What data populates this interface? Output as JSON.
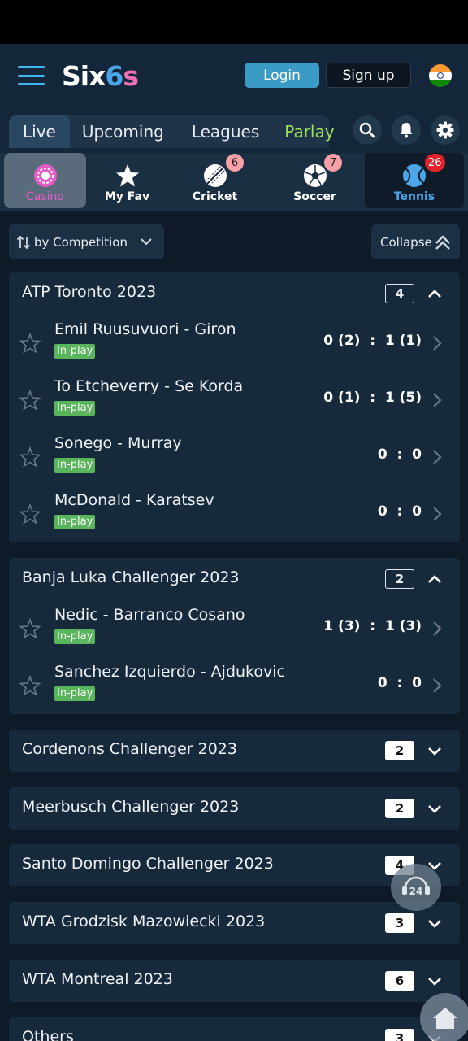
{
  "header": {
    "logo": {
      "part1": "Six",
      "part2": "6",
      "part3": "s"
    },
    "login_label": "Login",
    "signup_label": "Sign up",
    "flag": "india-flag-icon"
  },
  "tabs": [
    {
      "label": "Live",
      "active": true
    },
    {
      "label": "Upcoming"
    },
    {
      "label": "Leagues"
    },
    {
      "label": "Parlay"
    }
  ],
  "sports": [
    {
      "label": "Casino"
    },
    {
      "label": "My Fav"
    },
    {
      "label": "Cricket",
      "badge": "6"
    },
    {
      "label": "Soccer",
      "badge": "7"
    },
    {
      "label": "Tennis",
      "badge": "26",
      "active": true
    }
  ],
  "controls": {
    "sort_label": "by Competition",
    "collapse_label": "Collapse"
  },
  "competitions": [
    {
      "name": "ATP Toronto 2023",
      "count": "4",
      "expanded": true,
      "matches": [
        {
          "name": "Emil Ruusuvuori - Giron",
          "status": "In-play",
          "score": "0 (2)  :  1 (1)"
        },
        {
          "name": "To Etcheverry - Se Korda",
          "status": "In-play",
          "score": "0 (1)  :  1 (5)"
        },
        {
          "name": "Sonego - Murray",
          "status": "In-play",
          "score": "0  :  0"
        },
        {
          "name": "McDonald - Karatsev",
          "status": "In-play",
          "score": "0  :  0"
        }
      ]
    },
    {
      "name": "Banja Luka Challenger 2023",
      "count": "2",
      "expanded": true,
      "matches": [
        {
          "name": "Nedic - Barranco Cosano",
          "status": "In-play",
          "score": "1 (3)  :  1 (3)"
        },
        {
          "name": "Sanchez Izquierdo - Ajdukovic",
          "status": "In-play",
          "score": "0  :  0"
        }
      ]
    },
    {
      "name": "Cordenons Challenger 2023",
      "count": "2",
      "expanded": false
    },
    {
      "name": "Meerbusch Challenger 2023",
      "count": "2",
      "expanded": false
    },
    {
      "name": "Santo Domingo Challenger 2023",
      "count": "4",
      "expanded": false
    },
    {
      "name": "WTA Grodzisk Mazowiecki 2023",
      "count": "3",
      "expanded": false
    },
    {
      "name": "WTA Montreal 2023",
      "count": "6",
      "expanded": false
    },
    {
      "name": "Others",
      "count": "3",
      "expanded": false
    }
  ],
  "floating": {
    "support_label": "24"
  },
  "colors": {
    "background": "#0e1a28",
    "accent": "#3fb6ea",
    "parlay": "#9ee15a",
    "inplay": "#59b55b",
    "casino": "#e55bc7"
  }
}
